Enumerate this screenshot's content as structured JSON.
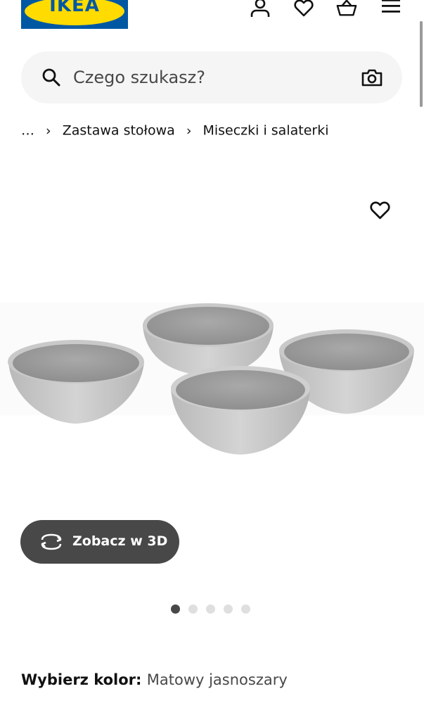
{
  "header": {
    "logo_text": "IKEA",
    "icons": [
      "profile-icon",
      "heart-icon",
      "basket-icon",
      "menu-icon"
    ]
  },
  "search": {
    "placeholder": "Czego szukasz?",
    "left_icon": "search-icon",
    "right_icon": "camera-icon"
  },
  "breadcrumb": {
    "items": [
      "…",
      "Zastawa stołowa",
      "Miseczki i salaterki"
    ],
    "separator": "›"
  },
  "product": {
    "favorite_icon": "heart-outline-icon",
    "view_3d_label": "Zobacz w 3D",
    "view_3d_icon": "rotate-3d-icon",
    "image_count": 5,
    "active_image": 1
  },
  "color": {
    "label": "Wybierz kolor:",
    "value": "Matowy jasnoszary"
  },
  "colors": {
    "brand_blue": "#0058a3",
    "brand_yellow": "#ffdb00",
    "button_dark": "#484848",
    "search_bg": "#f5f5f5"
  }
}
